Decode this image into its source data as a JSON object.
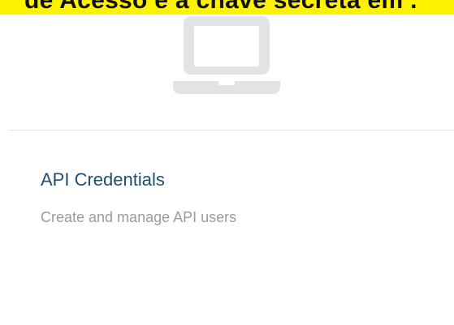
{
  "banner": {
    "text": "de Acesso e a chave secreta em .",
    "color": "#fff200"
  },
  "card": {
    "icon": "laptop-icon",
    "title": "API Credentials",
    "description": "Create and manage API users",
    "title_color": "#1f4e6e",
    "description_color": "#9b9b9b",
    "icon_color": "#e3e3e3"
  }
}
